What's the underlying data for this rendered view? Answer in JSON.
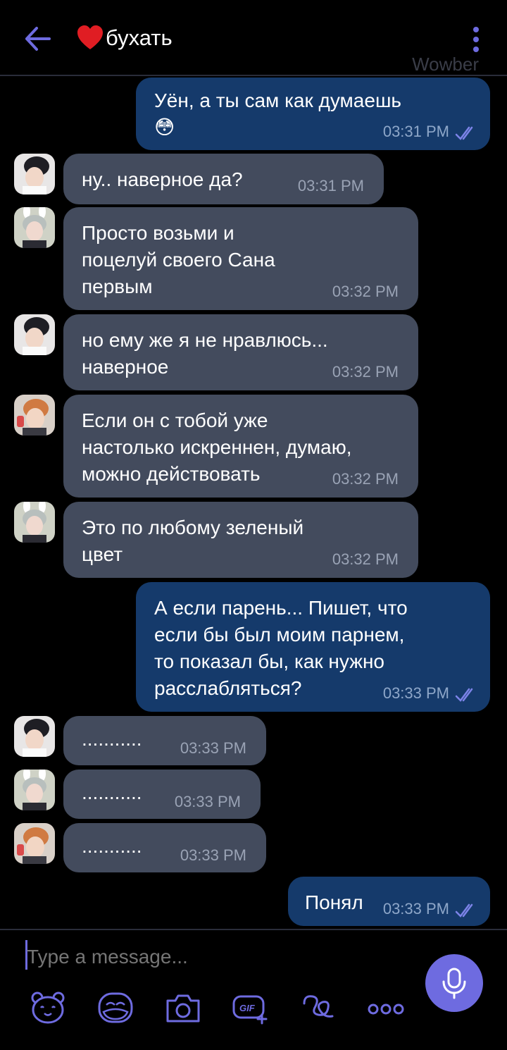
{
  "header": {
    "title": "бухать",
    "watermark": "Wowber"
  },
  "messages": [
    {
      "side": "out",
      "text": "Уён, а ты сам как думаешь\n😳",
      "time": "03:31 PM"
    },
    {
      "side": "in",
      "text": "ну.. наверное да?",
      "time": "03:31 PM"
    },
    {
      "side": "in",
      "text": "Просто возьми и\nпоцелуй своего Сана\nпервым",
      "time": "03:32 PM"
    },
    {
      "side": "in",
      "text": "но ему же я не нравлюсь...\nнаверное",
      "time": "03:32 PM"
    },
    {
      "side": "in",
      "text": "Если он с тобой уже\nнастолько искреннен, думаю,\nможно действовать",
      "time": "03:32 PM"
    },
    {
      "side": "in",
      "text": "Это по любому зеленый\nцвет",
      "time": "03:32 PM"
    },
    {
      "side": "out",
      "text": "А если парень... Пишет, что\nесли бы был моим парнем,\nто показал бы, как нужно\nрасслабляться?",
      "time": "03:33 PM"
    },
    {
      "side": "in",
      "text": "...........",
      "time": "03:33 PM"
    },
    {
      "side": "in",
      "text": "...........",
      "time": "03:33 PM"
    },
    {
      "side": "in",
      "text": "...........",
      "time": "03:33 PM"
    },
    {
      "side": "out",
      "text": "Понял",
      "time": "03:33 PM"
    }
  ],
  "composer": {
    "placeholder": "Type a message..."
  },
  "icons": {
    "back": "back-arrow-icon",
    "menu": "kebab-menu-icon",
    "mic": "microphone-icon",
    "tools": [
      "sticker-bear-icon",
      "emoji-icon",
      "camera-icon",
      "gif-icon",
      "doodle-icon",
      "more-icon"
    ]
  },
  "colors": {
    "accent": "#6e6be0",
    "incoming_bubble": "#434b5d",
    "outgoing_bubble": "#153a6b",
    "background": "#000000"
  }
}
